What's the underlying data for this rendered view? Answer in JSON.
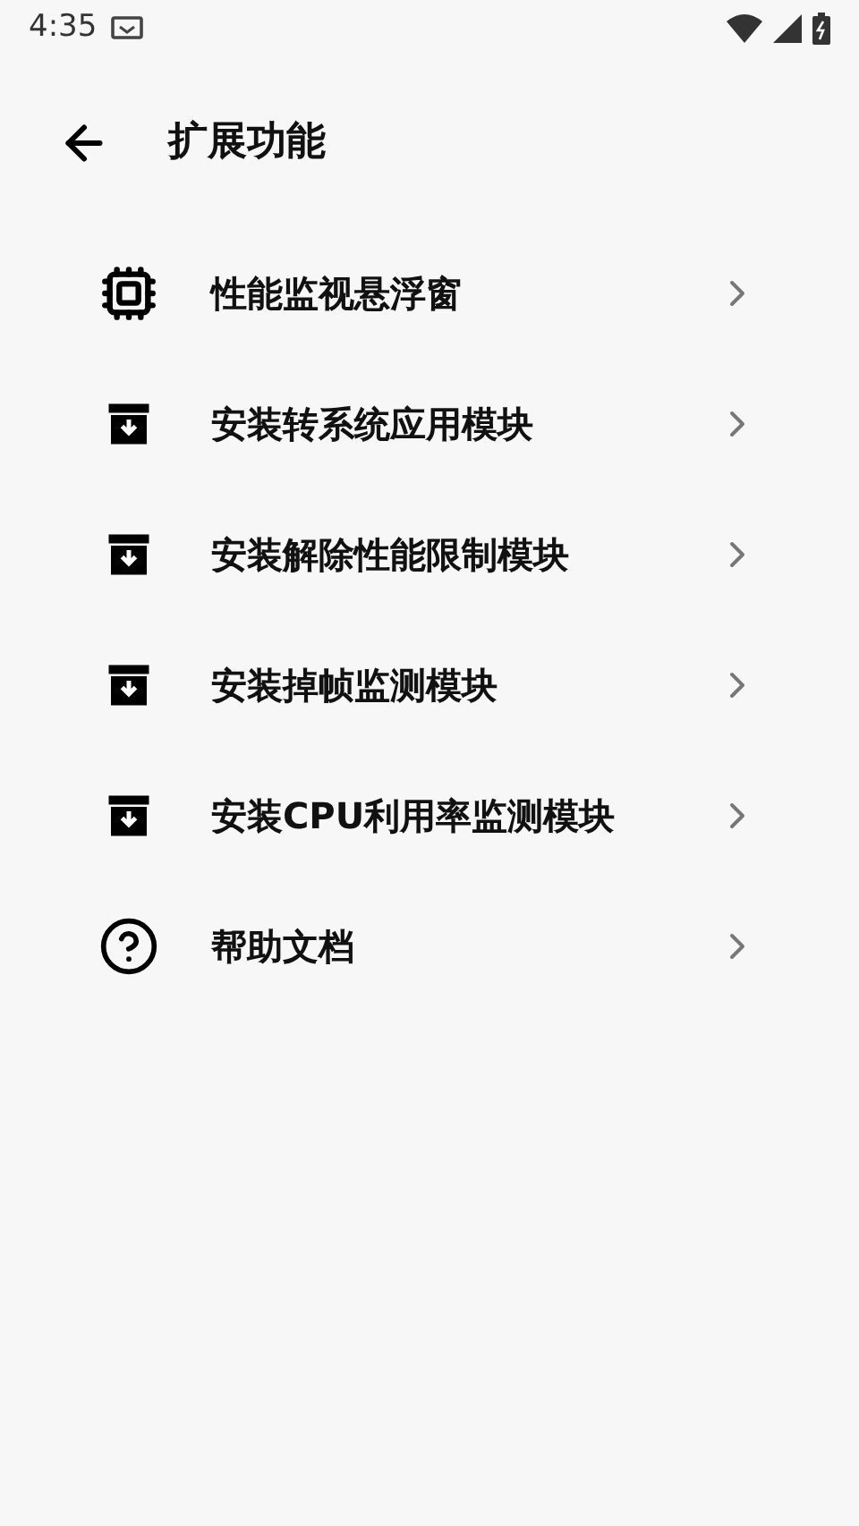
{
  "status_bar": {
    "time": "4:35"
  },
  "header": {
    "title": "扩展功能"
  },
  "items": [
    {
      "kind": "chip",
      "label": "性能监视悬浮窗"
    },
    {
      "kind": "archive",
      "label": "安装转系统应用模块"
    },
    {
      "kind": "archive",
      "label": "安装解除性能限制模块"
    },
    {
      "kind": "archive",
      "label": "安装掉帧监测模块"
    },
    {
      "kind": "archive",
      "label": "安装CPU利用率监测模块"
    },
    {
      "kind": "help",
      "label": "帮助文档"
    }
  ]
}
